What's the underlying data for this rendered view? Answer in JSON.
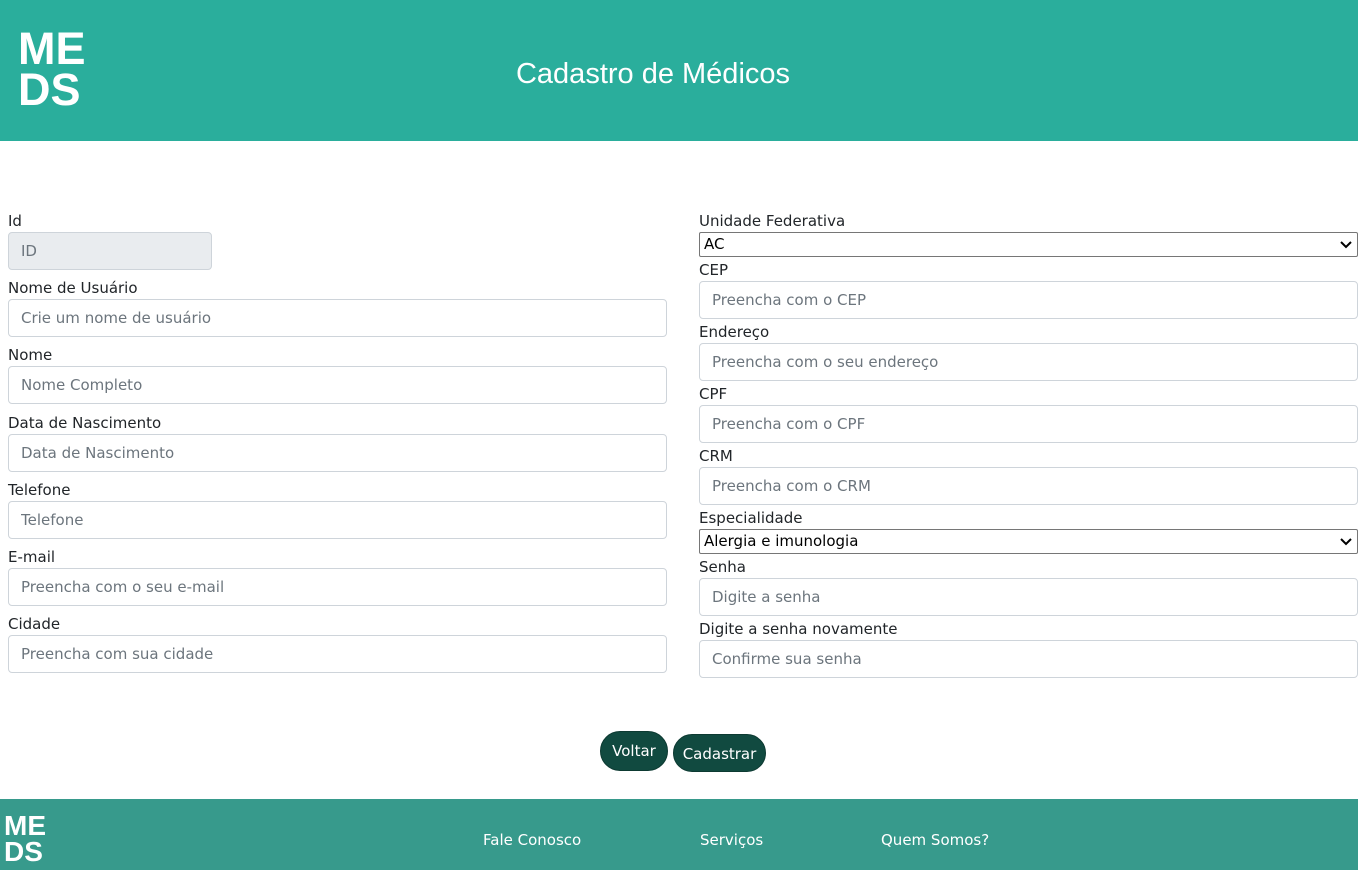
{
  "header": {
    "logo_line1": "ME",
    "logo_line2": "DS",
    "title": "Cadastro de Médicos"
  },
  "form_left": [
    {
      "label": "Id",
      "placeholder": "ID",
      "disabled": true
    },
    {
      "label": "Nome de Usuário",
      "placeholder": "Crie um nome de usuário"
    },
    {
      "label": "Nome",
      "placeholder": "Nome Completo"
    },
    {
      "label": "Data de Nascimento",
      "placeholder": "Data de Nascimento"
    },
    {
      "label": "Telefone",
      "placeholder": "Telefone"
    },
    {
      "label": "E-mail",
      "placeholder": "Preencha com o seu e-mail"
    },
    {
      "label": "Cidade",
      "placeholder": "Preencha com sua cidade"
    }
  ],
  "form_right": {
    "uf": {
      "label": "Unidade Federativa",
      "value": "AC"
    },
    "cep": {
      "label": "CEP",
      "placeholder": "Preencha com o CEP"
    },
    "endereco": {
      "label": "Endereço",
      "placeholder": "Preencha com o seu endereço"
    },
    "cpf": {
      "label": "CPF",
      "placeholder": "Preencha com o CPF"
    },
    "crm": {
      "label": "CRM",
      "placeholder": "Preencha com o CRM"
    },
    "especialidade": {
      "label": "Especialidade",
      "value": "Alergia e imunologia"
    },
    "senha": {
      "label": "Senha",
      "placeholder": "Digite a senha"
    },
    "senha2": {
      "label": "Digite a senha novamente",
      "placeholder": "Confirme sua senha"
    }
  },
  "buttons": {
    "back": "Voltar",
    "submit": "Cadastrar"
  },
  "footer": {
    "logo_line1": "ME",
    "logo_line2": "DS",
    "links": [
      "Fale Conosco",
      "Serviços",
      "Quem Somos?"
    ]
  },
  "colors": {
    "header_bg": "#2aae9c",
    "footer_bg": "#379a8c",
    "button_bg": "#114a40"
  }
}
